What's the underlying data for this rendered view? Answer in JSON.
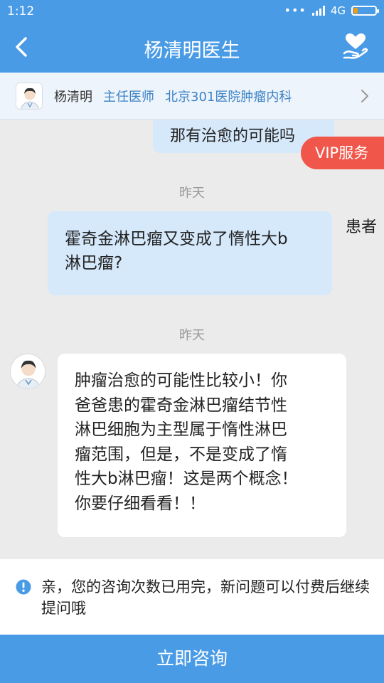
{
  "status_bar": {
    "time": "1:12",
    "network": "4G",
    "battery_level": 0.2
  },
  "nav": {
    "title": "杨清明医生",
    "back_icon": "chevron-left-icon",
    "right_icon": "heart-hand-icon"
  },
  "doctor": {
    "name": "杨清明",
    "title": "主任医师",
    "hospital": "北京301医院肿瘤内科"
  },
  "chat": {
    "previous_message_fragment": "那有治愈的可能吗",
    "vip_label": "VIP服务",
    "messages": [
      {
        "time": "昨天",
        "sender_label": "患者",
        "text_lines": [
          "霍奇金淋巴瘤又变成了惰性大b",
          "淋巴瘤?"
        ]
      },
      {
        "time": "昨天",
        "sender": "doctor",
        "text_lines": [
          "肿瘤治愈的可能性比较小！你",
          "爸爸患的霍奇金淋巴瘤结节性",
          "淋巴细胞为主型属于惰性淋巴",
          "瘤范围，但是，不是变成了惰",
          "性大b淋巴瘤！这是两个概念！",
          "你要仔细看看！！"
        ]
      }
    ]
  },
  "notice": {
    "icon": "info-icon",
    "text": "亲，您的咨询次数已用完，新问题可以付费后继续提问哦"
  },
  "consult_button": {
    "label": "立即咨询"
  },
  "colors": {
    "primary": "#4a9be6",
    "patient_bubble": "#d6e9fb",
    "vip": "#f0564a",
    "link_blue": "#3b82c4"
  }
}
